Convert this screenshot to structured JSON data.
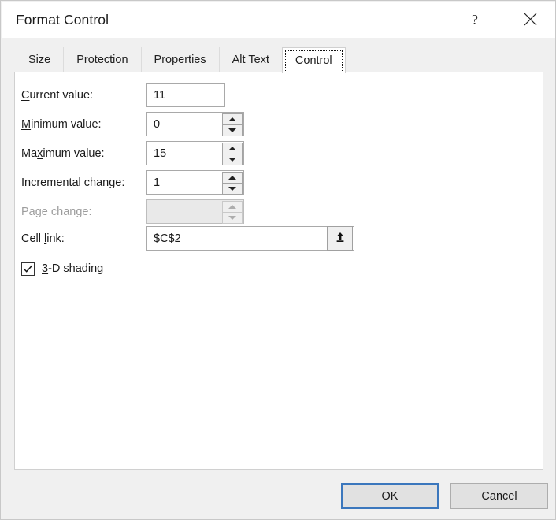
{
  "window": {
    "title": "Format Control",
    "help_icon": "question-mark-icon",
    "help_label": "?",
    "close_icon": "close-icon"
  },
  "tabs": [
    {
      "label": "Size",
      "accesskey_index": -1,
      "active": false
    },
    {
      "label": "Protection",
      "accesskey_index": 1,
      "active": false
    },
    {
      "label": "Properties",
      "accesskey_index": -1,
      "active": false
    },
    {
      "label": "Alt Text",
      "accesskey_index": -1,
      "active": false
    },
    {
      "label": "Control",
      "accesskey_index": -1,
      "active": true
    }
  ],
  "control_tab": {
    "fields": [
      {
        "name": "current-value",
        "label_before": "",
        "accesskey": "C",
        "label_after": "urrent value:",
        "value": "11",
        "has_spinner": false,
        "disabled": false
      },
      {
        "name": "minimum-value",
        "label_before": "",
        "accesskey": "M",
        "label_after": "inimum value:",
        "value": "0",
        "has_spinner": true,
        "disabled": false
      },
      {
        "name": "maximum-value",
        "label_before": "Ma",
        "accesskey": "x",
        "label_after": "imum value:",
        "value": "15",
        "has_spinner": true,
        "disabled": false
      },
      {
        "name": "incremental-change",
        "label_before": "",
        "accesskey": "I",
        "label_after": "ncremental change:",
        "value": "1",
        "has_spinner": true,
        "disabled": false
      },
      {
        "name": "page-change",
        "label_before": "Page change:",
        "accesskey": "",
        "label_after": "",
        "value": "",
        "has_spinner": true,
        "disabled": true
      }
    ],
    "cell_link": {
      "label_before": "Cell ",
      "accesskey": "l",
      "label_after": "ink:",
      "value": "$C$2",
      "picker_icon": "collapse-dialog-arrow-icon"
    },
    "shading": {
      "label_before": "",
      "accesskey": "3",
      "label_after": "-D shading",
      "checked": true,
      "check_glyph": "checkmark-icon"
    }
  },
  "footer": {
    "ok_label": "OK",
    "cancel_label": "Cancel"
  },
  "colors": {
    "dialog_bg": "#f0f0f0",
    "panel_bg": "#ffffff",
    "focus_blue": "#3b77bd",
    "disabled_text": "#9d9d9d"
  }
}
